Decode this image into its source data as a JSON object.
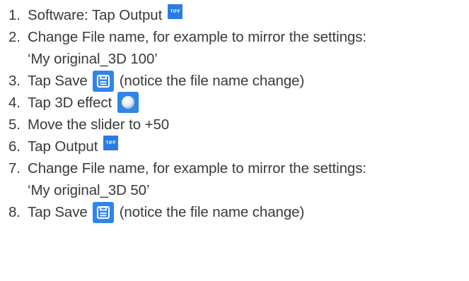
{
  "icons": {
    "tiff": {
      "name": "tiff-icon",
      "text": "TIFF",
      "color": "#2b7be4"
    },
    "save": {
      "name": "save-icon",
      "color": "#2f86e8"
    },
    "effect3d": {
      "name": "sphere-icon",
      "color": "#2f86e8"
    }
  },
  "steps": [
    {
      "num": "1.",
      "text": "Software: Tap Output"
    },
    {
      "num": "2.",
      "text": "Change File name, for example to mirror the settings:",
      "cont": "‘My original_3D 100’"
    },
    {
      "num": "3.",
      "text": "Tap Save",
      "after": "(notice the file name change)"
    },
    {
      "num": "4.",
      "text": "Tap 3D effect"
    },
    {
      "num": "5.",
      "text": "Move the slider to +50"
    },
    {
      "num": "6.",
      "text": "Tap Output"
    },
    {
      "num": "7.",
      "text": "Change File name, for example to mirror the settings:",
      "cont": "‘My original_3D 50’"
    },
    {
      "num": "8.",
      "text": "Tap Save",
      "after": "(notice the file name change)"
    }
  ]
}
